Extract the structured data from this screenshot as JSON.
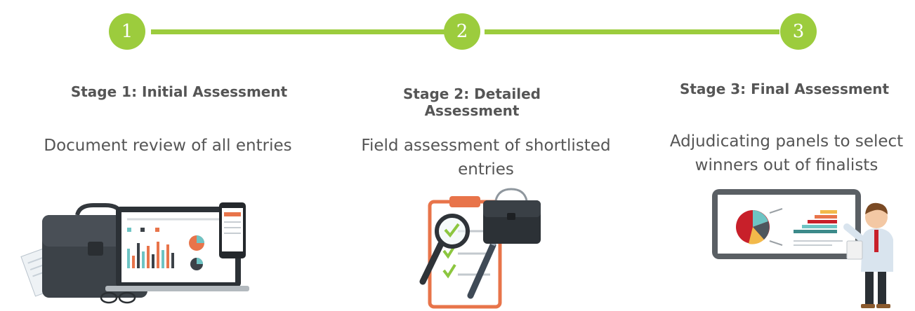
{
  "stages": [
    {
      "number": "1",
      "title": "Stage 1: Initial Assessment",
      "description": "Document review of all entries"
    },
    {
      "number": "2",
      "title": "Stage 2: Detailed Assessment",
      "description": "Field assessment of shortlisted entries"
    },
    {
      "number": "3",
      "title": "Stage 3: Final Assessment",
      "description": "Adjudicating panels to select winners out of finalists"
    }
  ],
  "colors": {
    "accent": "#9ccc3d",
    "text": "#555555"
  },
  "icons": [
    "briefcase-laptop-phone-illustration",
    "clipboard-magnifier-illustration",
    "presenter-chart-illustration"
  ]
}
